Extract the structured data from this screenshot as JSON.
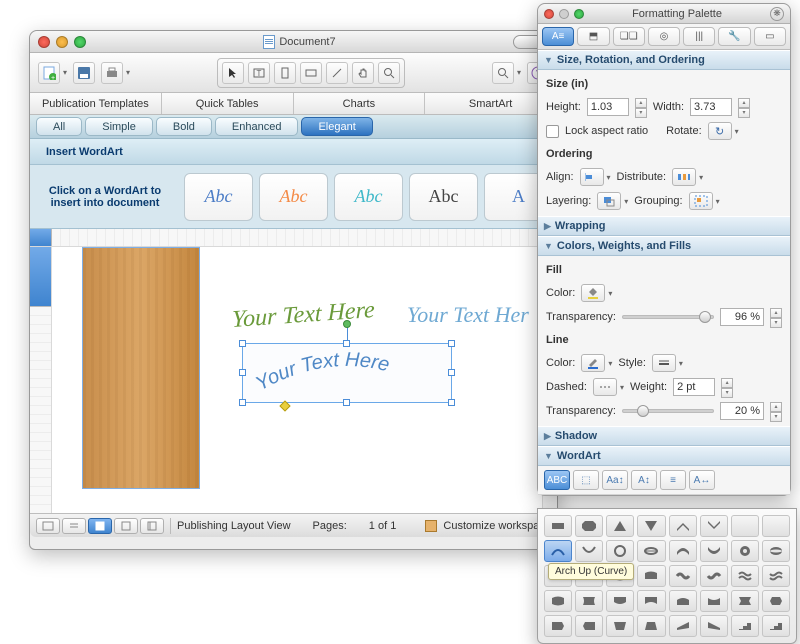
{
  "main_window": {
    "title": "Document7",
    "tabs": [
      "Publication Templates",
      "Quick Tables",
      "Charts",
      "SmartArt"
    ],
    "style_tabs": [
      "All",
      "Simple",
      "Bold",
      "Enhanced",
      "Elegant"
    ],
    "style_active_index": 4,
    "insert_label": "Insert WordArt",
    "hint": "Click on a WordArt to insert into document",
    "wordart_samples": [
      "Abc",
      "Abc",
      "Abc",
      "Abc",
      "A"
    ],
    "canvas": {
      "wordart1": "Your Text Here",
      "wordart2": "Your Text Her",
      "wordart3": "Your Text Here"
    },
    "statusbar": {
      "view_label": "Publishing Layout View",
      "pages_label": "Pages:",
      "pages_value": "1 of 1",
      "customize": "Customize workspace"
    }
  },
  "palette": {
    "title": "Formatting Palette",
    "sections": {
      "size": {
        "header": "Size, Rotation, and Ordering",
        "size_label": "Size (in)",
        "height_label": "Height:",
        "height_value": "1.03",
        "width_label": "Width:",
        "width_value": "3.73",
        "lock_label": "Lock aspect ratio",
        "rotate_label": "Rotate:",
        "ordering_label": "Ordering",
        "align_label": "Align:",
        "distribute_label": "Distribute:",
        "layering_label": "Layering:",
        "grouping_label": "Grouping:"
      },
      "wrapping": {
        "header": "Wrapping"
      },
      "colors": {
        "header": "Colors, Weights, and Fills",
        "fill_label": "Fill",
        "color_label": "Color:",
        "transparency_label": "Transparency:",
        "fill_trans_value": "96 %",
        "line_label": "Line",
        "style_label": "Style:",
        "dashed_label": "Dashed:",
        "weight_label": "Weight:",
        "weight_value": "2 pt",
        "line_trans_value": "20 %"
      },
      "shadow": {
        "header": "Shadow"
      },
      "wordart": {
        "header": "WordArt"
      }
    }
  },
  "shape_popover": {
    "tooltip": "Arch Up (Curve)"
  }
}
